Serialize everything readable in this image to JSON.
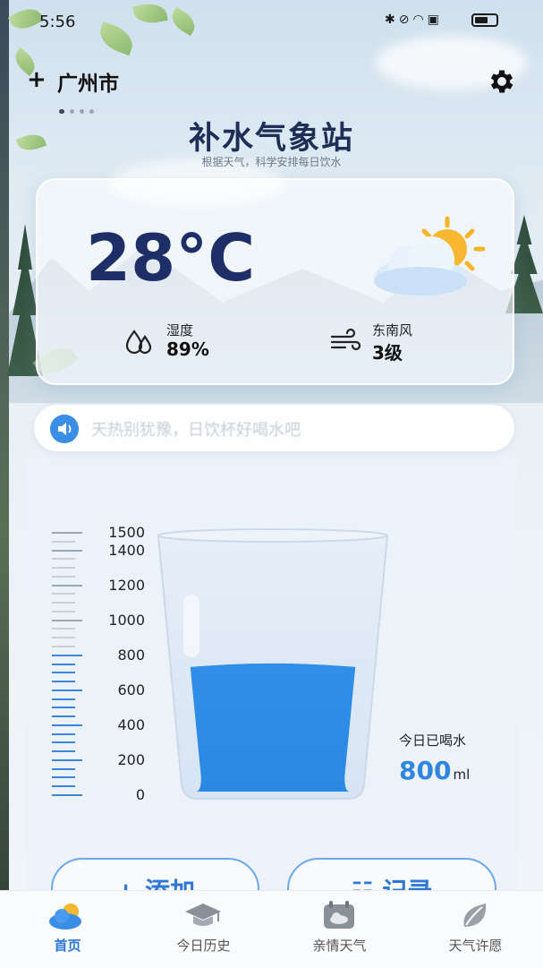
{
  "status_bar": {
    "time": "5:56"
  },
  "header": {
    "add_symbol": "+",
    "city": "广州市",
    "title": "补水气象站",
    "subtitle": "根据天气，科学安排每日饮水"
  },
  "weather": {
    "temperature": "28°C",
    "humidity_label": "湿度",
    "humidity_value": "89%",
    "wind_label": "东南风",
    "wind_value": "3级"
  },
  "notice": {
    "text": "天热别犹豫，日饮杯好喝水吧"
  },
  "water": {
    "scale_labels": [
      "1500",
      "1400",
      "1200",
      "1000",
      "800",
      "600",
      "400",
      "200",
      "0"
    ],
    "level_ml": 800,
    "max_ml": 1500,
    "drank_label": "今日已喝水",
    "drank_value": "800",
    "drank_unit": "ml"
  },
  "actions": {
    "add_label": "+ 添加",
    "record_label": "☷ 记录"
  },
  "nav": {
    "items": [
      {
        "label": "首页",
        "icon": "weather-icon",
        "active": true
      },
      {
        "label": "今日历史",
        "icon": "graduation-cap-icon",
        "active": false
      },
      {
        "label": "亲情天气",
        "icon": "calendar-cloud-icon",
        "active": false
      },
      {
        "label": "天气许愿",
        "icon": "leaf-icon",
        "active": false
      }
    ]
  },
  "colors": {
    "accent": "#2f86de",
    "title": "#1d2f56",
    "water": "#2f8fe8"
  }
}
